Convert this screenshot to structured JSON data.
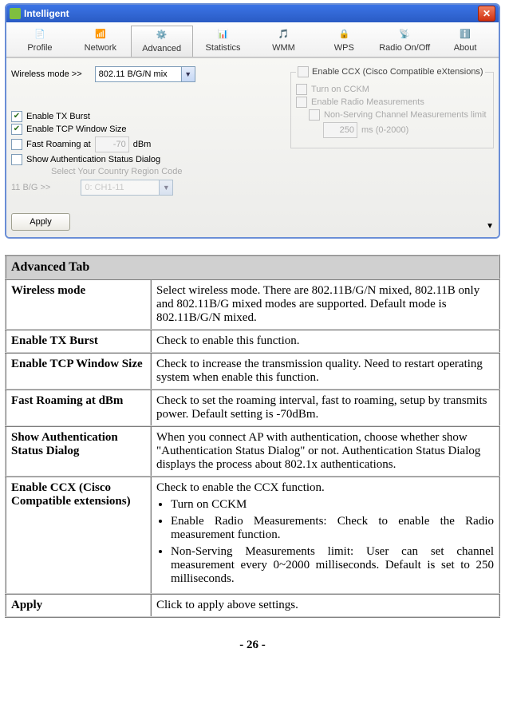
{
  "window": {
    "title": "Intelligent",
    "close_tooltip": "Close"
  },
  "toolbar": {
    "items": [
      {
        "label": "Profile",
        "icon": "profile"
      },
      {
        "label": "Network",
        "icon": "network"
      },
      {
        "label": "Advanced",
        "icon": "advanced",
        "selected": true
      },
      {
        "label": "Statistics",
        "icon": "statistics"
      },
      {
        "label": "WMM",
        "icon": "wmm"
      },
      {
        "label": "WPS",
        "icon": "wps"
      },
      {
        "label": "Radio On/Off",
        "icon": "radio"
      },
      {
        "label": "About",
        "icon": "about"
      }
    ]
  },
  "form": {
    "wireless_mode_label": "Wireless mode >>",
    "wireless_mode_value": "802.11 B/G/N mix",
    "enable_tx_burst": {
      "label": "Enable TX Burst",
      "checked": true
    },
    "enable_tcp_win": {
      "label": "Enable TCP Window Size",
      "checked": true
    },
    "fast_roaming": {
      "label": "Fast Roaming at",
      "checked": false,
      "value": "-70",
      "unit": "dBm"
    },
    "show_auth_dialog": {
      "label": "Show Authentication Status Dialog",
      "checked": false
    },
    "country_label": "Select Your Country Region Code",
    "band_label": "11 B/G >>",
    "band_value": "0: CH1-11",
    "ccx": {
      "group_label": "Enable CCX (Cisco Compatible eXtensions)",
      "cckm": "Turn on CCKM",
      "radio_meas": "Enable Radio Measurements",
      "nonserv": "Non-Serving Channel Measurements limit",
      "ms_value": "250",
      "ms_unit": "ms (0-2000)"
    },
    "apply_label": "Apply"
  },
  "table": {
    "header": "Advanced Tab",
    "rows": [
      {
        "label": "Wireless mode",
        "desc": "Select wireless mode. There are 802.11B/G/N mixed, 802.11B only and 802.11B/G mixed modes are supported. Default mode is 802.11B/G/N mixed."
      },
      {
        "label": "Enable TX Burst",
        "desc": "Check to enable this function."
      },
      {
        "label": "Enable TCP Window Size",
        "desc": "Check to increase the transmission quality. Need to restart operating system when enable this function."
      },
      {
        "label": "Fast Roaming at dBm",
        "desc": "Check to set the roaming interval, fast to roaming, setup by transmits power. Default setting is -70dBm."
      },
      {
        "label": "Show Authentication Status Dialog",
        "desc": "When you connect AP with authentication, choose whether show \"Authentication Status Dialog\" or not. Authentication Status Dialog displays the process about 802.1x authentications."
      },
      {
        "label": "Enable CCX (Cisco Compatible extensions)",
        "desc_intro": "Check to enable the CCX function.",
        "bullets": [
          "Turn on CCKM",
          "Enable Radio Measurements: Check to enable the Radio measurement function.",
          "Non-Serving Measurements limit: User can set channel measurement every 0~2000 milliseconds. Default is set to 250 milliseconds."
        ]
      },
      {
        "label": "Apply",
        "desc": "Click to apply above above settings.",
        "desc_fixed": "Click to apply above settings."
      }
    ]
  },
  "page_number": "- 26 -"
}
